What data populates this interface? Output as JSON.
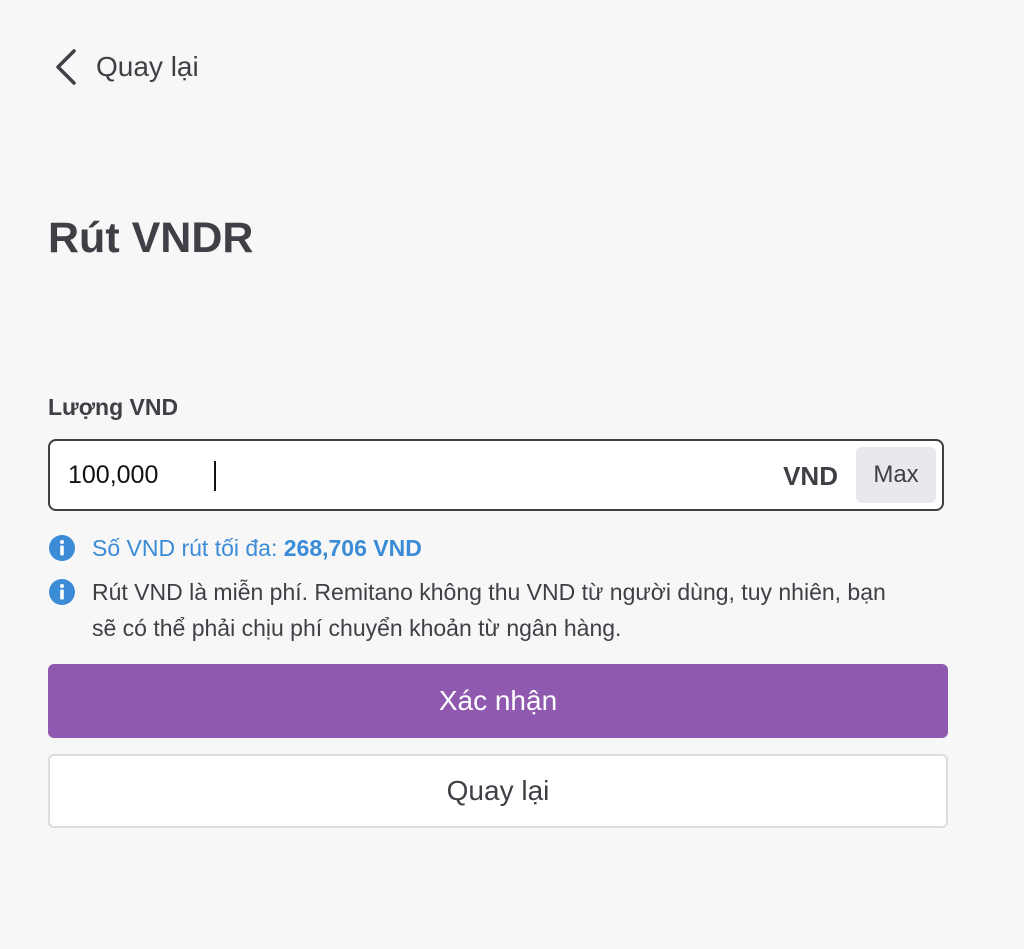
{
  "header": {
    "back_label": "Quay lại"
  },
  "page": {
    "title": "Rút VNDR"
  },
  "amount": {
    "label": "Lượng VND",
    "value": "100,000",
    "currency": "VND",
    "max_label": "Max"
  },
  "notes": {
    "max_prefix": "Số VND rút tối đa: ",
    "max_amount": "268,706 VND",
    "fee_text": "Rút VND là miễn phí. Remitano không thu VND từ người dùng, tuy nhiên, bạn sẽ có thể phải chịu phí chuyển khoản từ ngân hàng."
  },
  "actions": {
    "confirm_label": "Xác nhận",
    "back_label": "Quay lại"
  },
  "colors": {
    "accent": "#9059b0",
    "info": "#3b8bd6",
    "text": "#3f3f46"
  },
  "icons": {
    "back": "chevron-left-icon",
    "info": "info-circle-icon"
  }
}
